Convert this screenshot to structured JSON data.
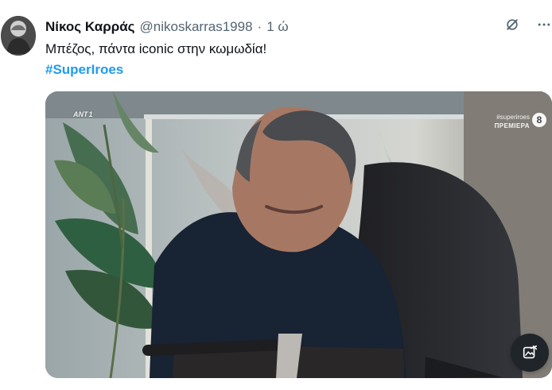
{
  "tweet": {
    "display_name": "Νίκος Καρράς",
    "handle": "@nikoskarras1998",
    "separator": "·",
    "timestamp": "1 ώ",
    "text": "Μπέζος, πάντα iconic στην κωμωδία!",
    "hashtag": "#SuperIroes"
  },
  "media": {
    "channel_logo": "ANT",
    "channel_logo_superscript": "1",
    "promo_tag": "#superiroes",
    "promo_label": "ΠΡΕΜΙΕΡΑ",
    "rating": "8"
  },
  "icons": {
    "grok": "grok-icon",
    "more": "more-icon",
    "media_edit": "image-edit-icon"
  },
  "colors": {
    "text": "#0f1419",
    "secondary_text": "#536471",
    "link": "#1d9bf0"
  }
}
